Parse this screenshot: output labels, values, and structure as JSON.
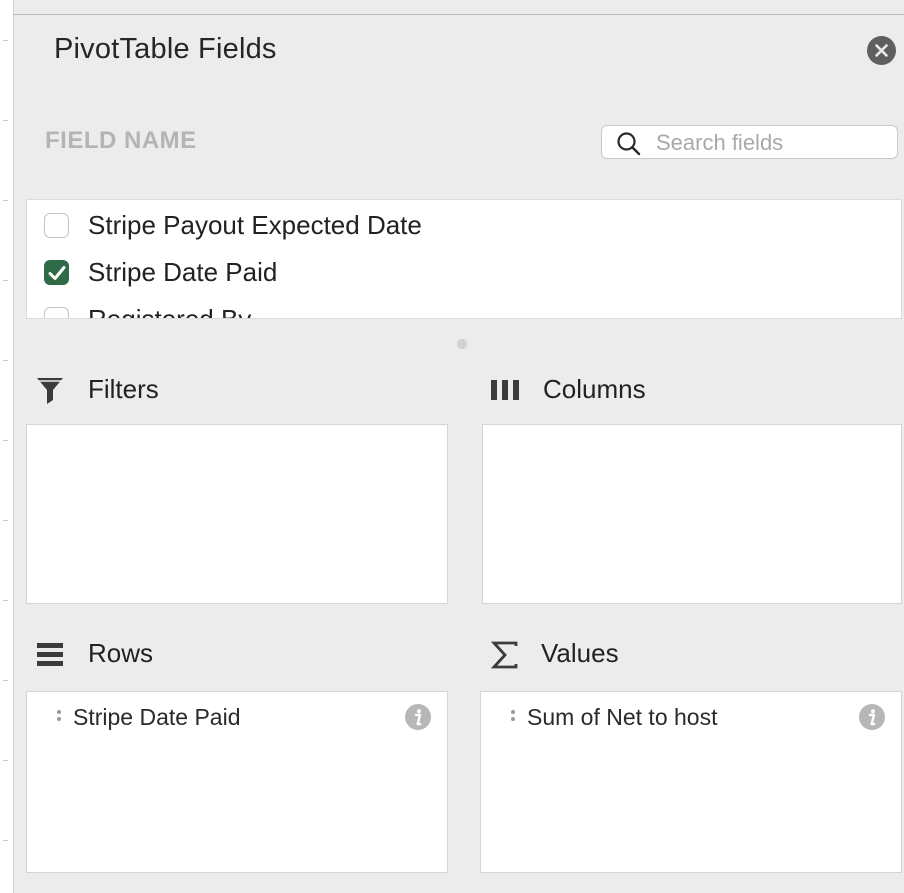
{
  "panel": {
    "title": "PivotTable Fields",
    "close_icon": "close-circle-icon"
  },
  "field_list": {
    "header": "FIELD NAME",
    "search": {
      "placeholder": "Search fields",
      "value": "",
      "icon": "search-icon"
    },
    "items": [
      {
        "label": "Stripe Payout Expected Date",
        "checked": false
      },
      {
        "label": "Stripe Date Paid",
        "checked": true
      },
      {
        "label": "Registered By",
        "checked": false
      }
    ]
  },
  "areas": {
    "filters": {
      "label": "Filters",
      "icon": "filter-funnel-icon",
      "fields": []
    },
    "columns": {
      "label": "Columns",
      "icon": "columns-icon",
      "fields": []
    },
    "rows": {
      "label": "Rows",
      "icon": "rows-icon",
      "fields": [
        {
          "label": "Stripe Date Paid"
        }
      ]
    },
    "values": {
      "label": "Values",
      "icon": "sigma-icon",
      "fields": [
        {
          "label": "Sum of Net to host"
        }
      ]
    }
  },
  "colors": {
    "panel_bg": "#ececec",
    "checkbox_checked": "#2e6b46",
    "muted_header": "#b4b4b4"
  }
}
